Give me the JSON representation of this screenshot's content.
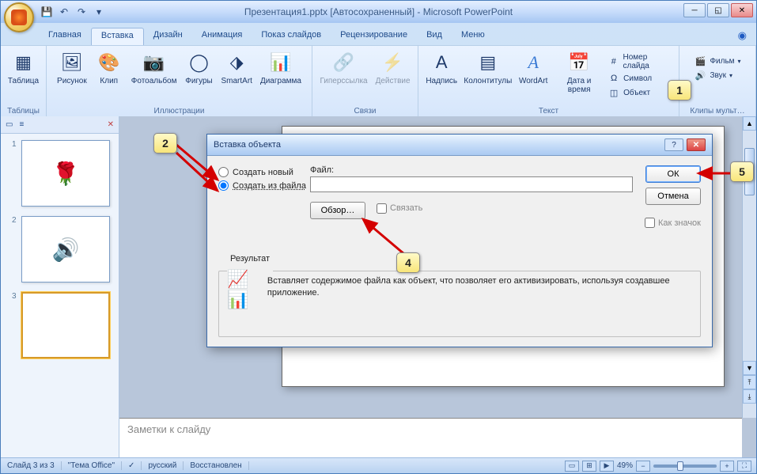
{
  "window": {
    "title": "Презентация1.pptx [Автосохраненный] - Microsoft PowerPoint",
    "qat": {
      "save": "💾",
      "undo": "↶",
      "redo": "↷",
      "more": "▾"
    }
  },
  "tabs": {
    "home": "Главная",
    "insert": "Вставка",
    "design": "Дизайн",
    "anim": "Анимация",
    "show": "Показ слайдов",
    "review": "Рецензирование",
    "view": "Вид",
    "menu": "Меню"
  },
  "ribbon": {
    "tables": {
      "label": "Таблицы",
      "table": "Таблица"
    },
    "illustrations": {
      "label": "Иллюстрации",
      "picture": "Рисунок",
      "clip": "Клип",
      "album": "Фотоальбом",
      "shapes": "Фигуры",
      "smartart": "SmartArt",
      "chart": "Диаграмма"
    },
    "links": {
      "label": "Связи",
      "hyperlink": "Гиперссылка",
      "action": "Действие"
    },
    "text": {
      "label": "Текст",
      "textbox": "Надпись",
      "headerfooter": "Колонтитулы",
      "wordart": "WordArt",
      "datetime": "Дата и время",
      "slidenum": "Номер слайда",
      "symbol": "Символ",
      "object": "Объект"
    },
    "media": {
      "label": "Клипы мульт…",
      "movie": "Фильм",
      "sound": "Звук"
    }
  },
  "thumbs": {
    "t1": "1",
    "t2": "2",
    "t3": "3"
  },
  "notes": {
    "placeholder": "Заметки к слайду"
  },
  "status": {
    "slide": "Слайд 3 из 3",
    "theme": "\"Тема Office\"",
    "lang": "русский",
    "saved": "Восстановлен",
    "zoom": "49%"
  },
  "dialog": {
    "title": "Вставка объекта",
    "create_new": "Создать новый",
    "create_from_file": "Создать из файла",
    "file_label": "Файл:",
    "browse": "Обзор…",
    "link": "Связать",
    "as_icon": "Как значок",
    "ok": "ОК",
    "cancel": "Отмена",
    "result_label": "Результат",
    "result_text": "Вставляет содержимое файла как объект, что позволяет его активизировать, используя создавшее приложение."
  },
  "callouts": {
    "c1": "1",
    "c2": "2",
    "c4": "4",
    "c5": "5"
  }
}
